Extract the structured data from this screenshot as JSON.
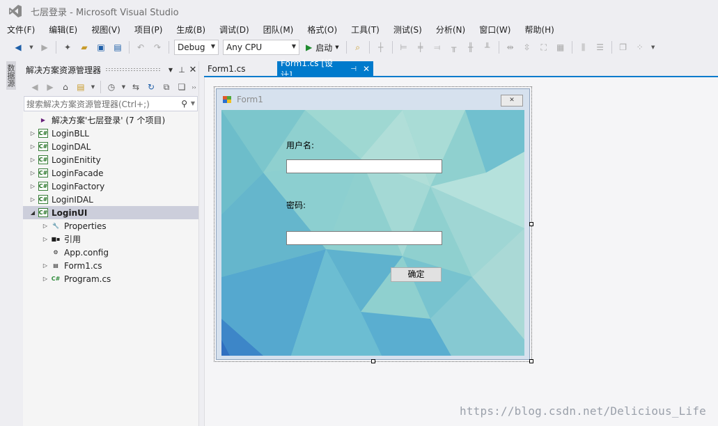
{
  "window": {
    "title": "七层登录 - Microsoft Visual Studio"
  },
  "menu": [
    "文件(F)",
    "编辑(E)",
    "视图(V)",
    "项目(P)",
    "生成(B)",
    "调试(D)",
    "团队(M)",
    "格式(O)",
    "工具(T)",
    "测试(S)",
    "分析(N)",
    "窗口(W)",
    "帮助(H)"
  ],
  "toolbar": {
    "configuration": "Debug",
    "platform": "Any CPU",
    "start_label": "启动"
  },
  "left_tab": {
    "label": "数据源"
  },
  "solution_explorer": {
    "title": "解决方案资源管理器",
    "search_placeholder": "搜索解决方案资源管理器(Ctrl+;)",
    "tree": [
      {
        "label": "解决方案'七层登录' (7 个项目)",
        "icon": "solution-icon",
        "level": 0,
        "expander": "",
        "selected": false
      },
      {
        "label": "LoginBLL",
        "icon": "csharp-project-icon",
        "level": 0,
        "expander": "collapsed",
        "selected": false
      },
      {
        "label": "LoginDAL",
        "icon": "csharp-project-icon",
        "level": 0,
        "expander": "collapsed",
        "selected": false
      },
      {
        "label": "LoginEnitity",
        "icon": "csharp-project-icon",
        "level": 0,
        "expander": "collapsed",
        "selected": false
      },
      {
        "label": "LoginFacade",
        "icon": "csharp-project-icon",
        "level": 0,
        "expander": "collapsed",
        "selected": false
      },
      {
        "label": "LoginFactory",
        "icon": "csharp-project-icon",
        "level": 0,
        "expander": "collapsed",
        "selected": false
      },
      {
        "label": "LoginIDAL",
        "icon": "csharp-project-icon",
        "level": 0,
        "expander": "collapsed",
        "selected": false
      },
      {
        "label": "LoginUI",
        "icon": "csharp-project-icon",
        "level": 0,
        "expander": "expanded",
        "selected": true
      },
      {
        "label": "Properties",
        "icon": "wrench-icon",
        "level": 1,
        "expander": "collapsed",
        "selected": false
      },
      {
        "label": "引用",
        "icon": "references-icon",
        "level": 1,
        "expander": "collapsed",
        "selected": false
      },
      {
        "label": "App.config",
        "icon": "config-file-icon",
        "level": 1,
        "expander": "",
        "selected": false
      },
      {
        "label": "Form1.cs",
        "icon": "form-file-icon",
        "level": 1,
        "expander": "collapsed",
        "selected": false
      },
      {
        "label": "Program.cs",
        "icon": "csharp-file-icon",
        "level": 1,
        "expander": "collapsed",
        "selected": false
      }
    ]
  },
  "doc_tabs": [
    {
      "label": "Form1.cs",
      "active": false
    },
    {
      "label": "Form1.cs [设计]",
      "active": true
    }
  ],
  "form": {
    "title": "Form1",
    "username_label": "用户名:",
    "username_value": "",
    "password_label": "密码:",
    "password_value": "",
    "ok_button": "确定"
  },
  "watermark": "https://blog.csdn.net/Delicious_Life",
  "colors": {
    "accent": "#007acc",
    "selected_row": "#cccedb",
    "start_green": "#1e8a2e"
  }
}
